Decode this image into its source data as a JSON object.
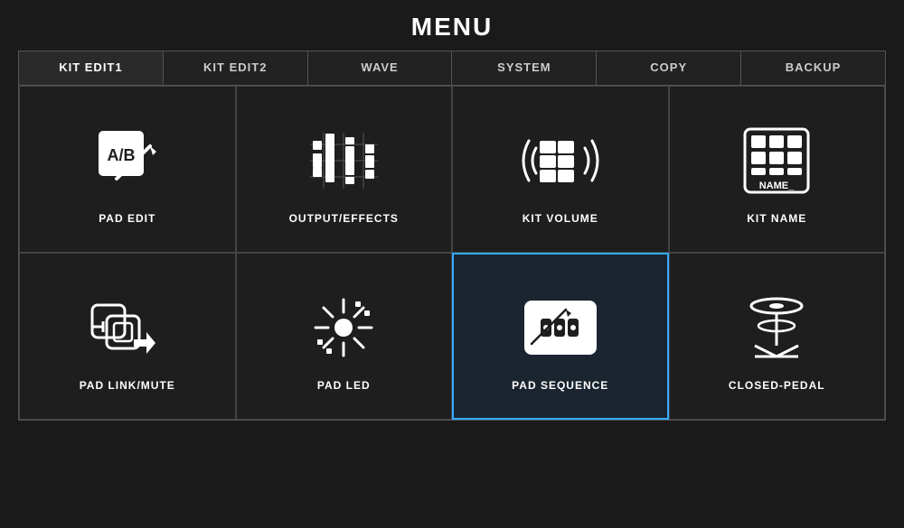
{
  "header": {
    "title": "MENU"
  },
  "tabs": [
    {
      "id": "kit-edit1",
      "label": "KIT EDIT1",
      "active": true
    },
    {
      "id": "kit-edit2",
      "label": "KIT EDIT2",
      "active": false
    },
    {
      "id": "wave",
      "label": "WAVE",
      "active": false
    },
    {
      "id": "system",
      "label": "SYSTEM",
      "active": false
    },
    {
      "id": "copy",
      "label": "COPY",
      "active": false
    },
    {
      "id": "backup",
      "label": "BACKUP",
      "active": false
    }
  ],
  "grid": [
    {
      "id": "pad-edit",
      "label": "PAD EDIT",
      "selected": false
    },
    {
      "id": "output-effects",
      "label": "OUTPUT/EFFECTS",
      "selected": false
    },
    {
      "id": "kit-volume",
      "label": "KIT VOLUME",
      "selected": false
    },
    {
      "id": "kit-name",
      "label": "KIT NAME",
      "selected": false
    },
    {
      "id": "pad-link-mute",
      "label": "PAD LINK/MUTE",
      "selected": false
    },
    {
      "id": "pad-led",
      "label": "PAD LED",
      "selected": false
    },
    {
      "id": "pad-sequence",
      "label": "PAD SEQUENCE",
      "selected": true
    },
    {
      "id": "closed-pedal",
      "label": "CLOSED-PEDAL",
      "selected": false
    }
  ]
}
